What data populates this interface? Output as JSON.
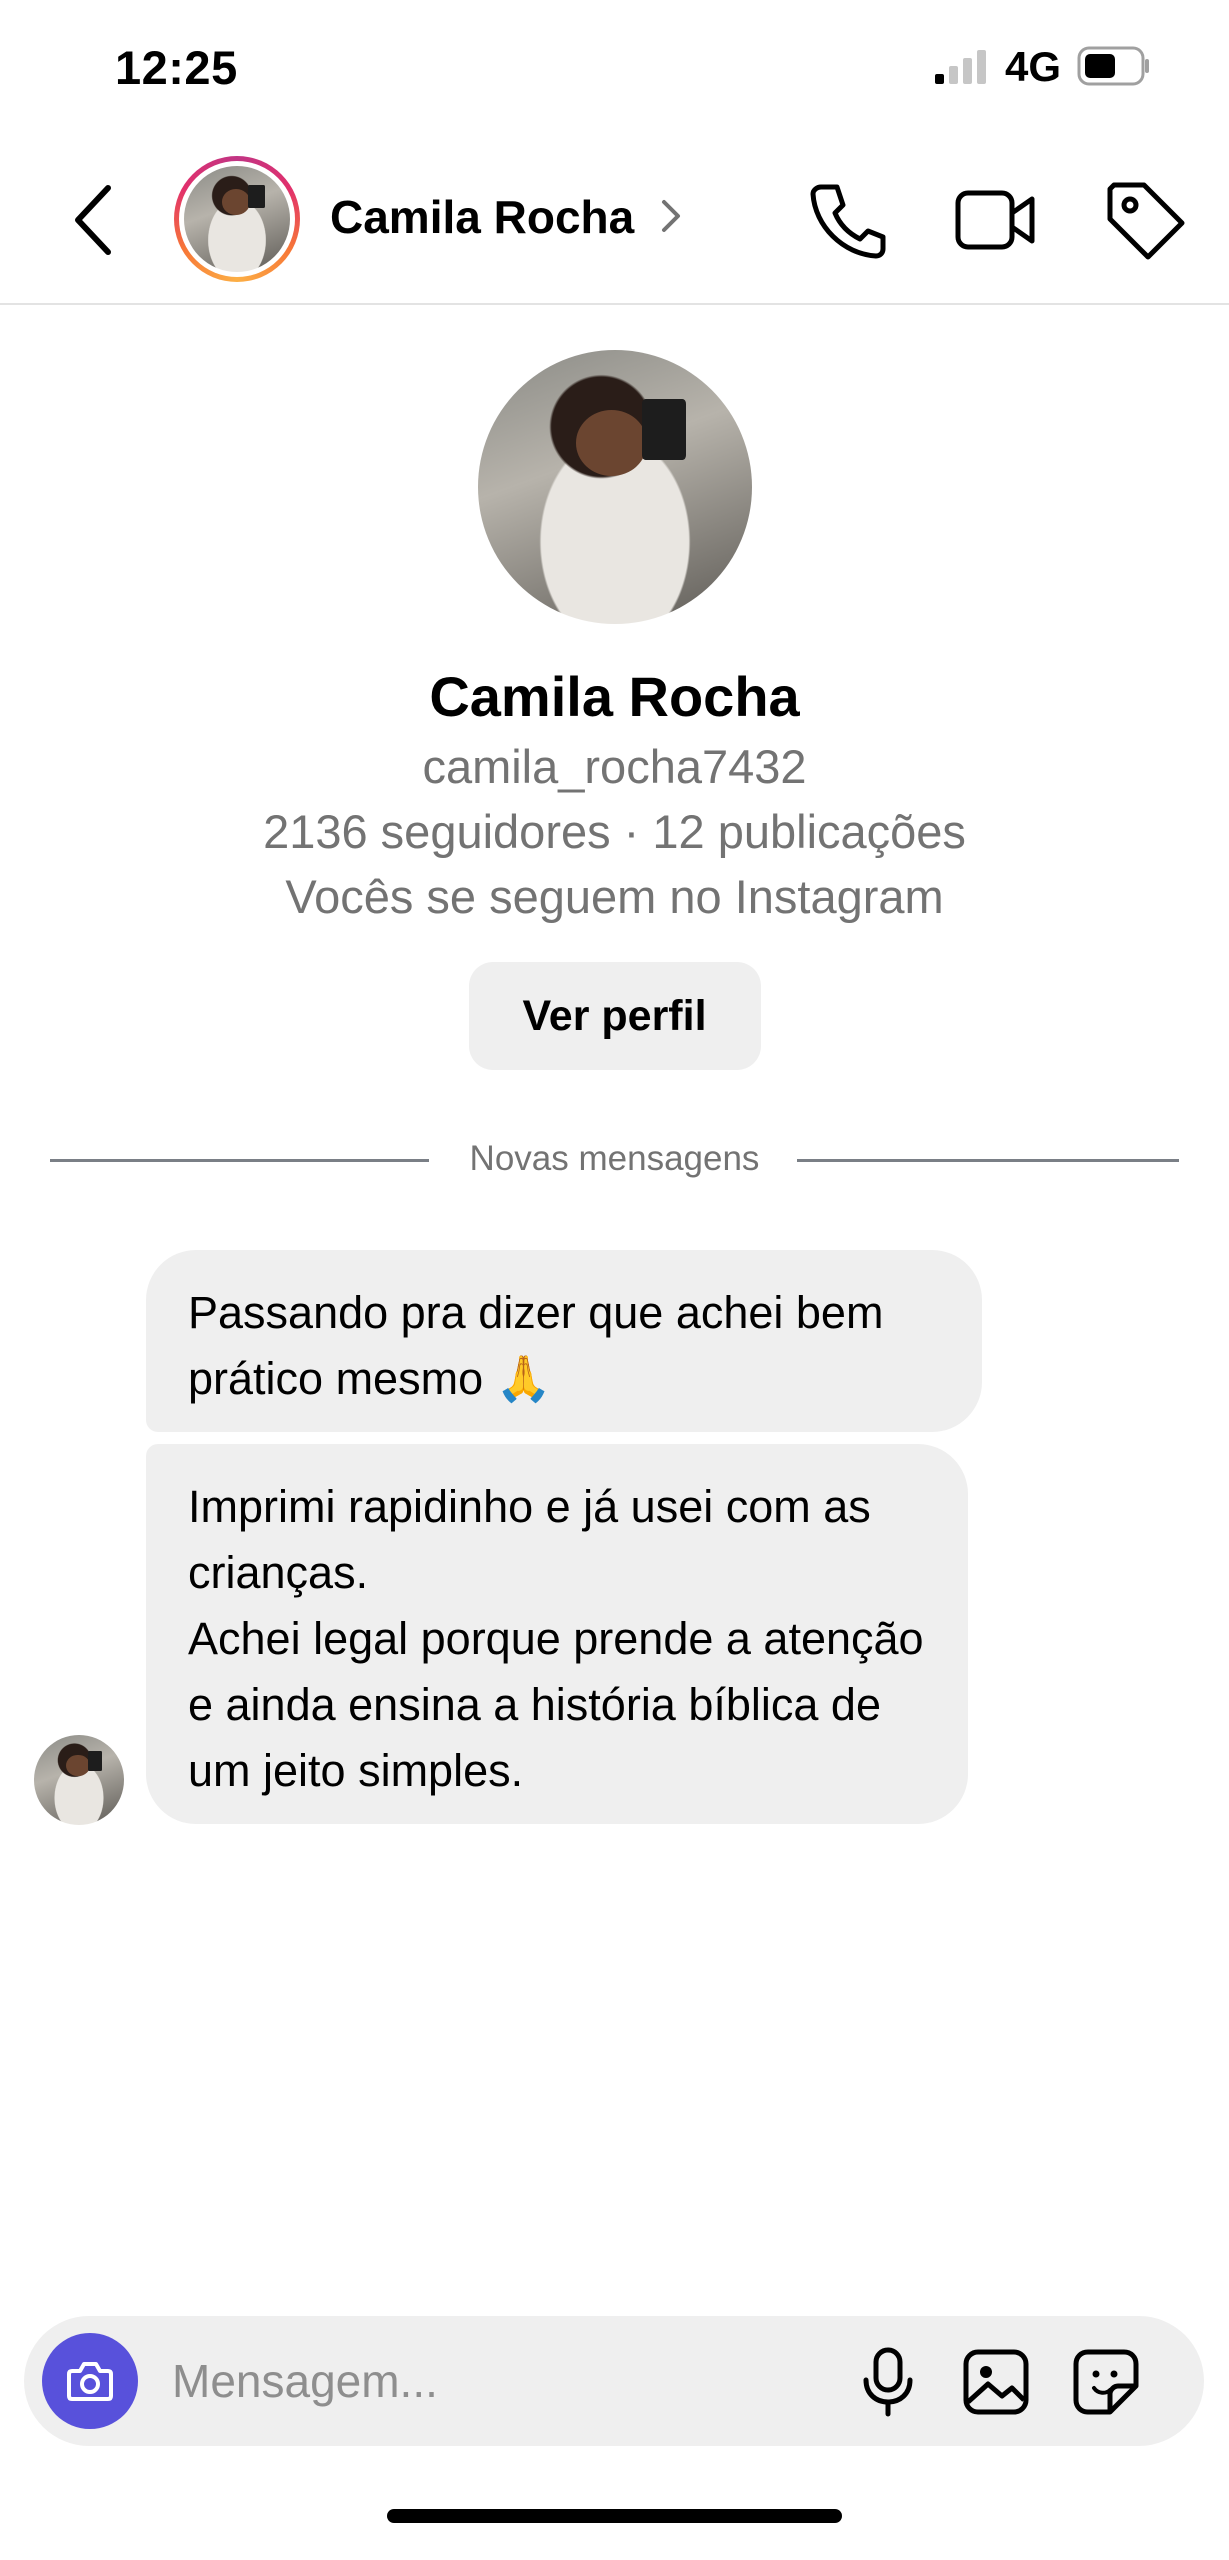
{
  "status_bar": {
    "time": "12:25",
    "network": "4G"
  },
  "header": {
    "contact_name": "Camila Rocha"
  },
  "profile": {
    "name": "Camila Rocha",
    "username": "camila_rocha7432",
    "stats": "2136 seguidores · 12 publicações",
    "mutual": "Vocês se seguem no Instagram",
    "view_profile_label": "Ver perfil"
  },
  "divider": {
    "label": "Novas mensagens"
  },
  "messages": [
    {
      "text": "Passando pra dizer que achei bem prático mesmo 🙏"
    },
    {
      "text": "Imprimi rapidinho e já usei com as crianças.\nAchei legal porque prende a atenção e ainda ensina a história bíblica de um jeito simples."
    }
  ],
  "composer": {
    "placeholder": "Mensagem..."
  },
  "icons": {
    "back": "chevron-left-icon",
    "call": "phone-icon",
    "video": "video-camera-icon",
    "tag": "tag-icon",
    "camera": "camera-icon",
    "mic": "microphone-icon",
    "gallery": "image-icon",
    "sticker": "sticker-icon"
  },
  "colors": {
    "camera_button": "#5851db",
    "bubble": "#efefef",
    "secondary_text": "#737373"
  }
}
